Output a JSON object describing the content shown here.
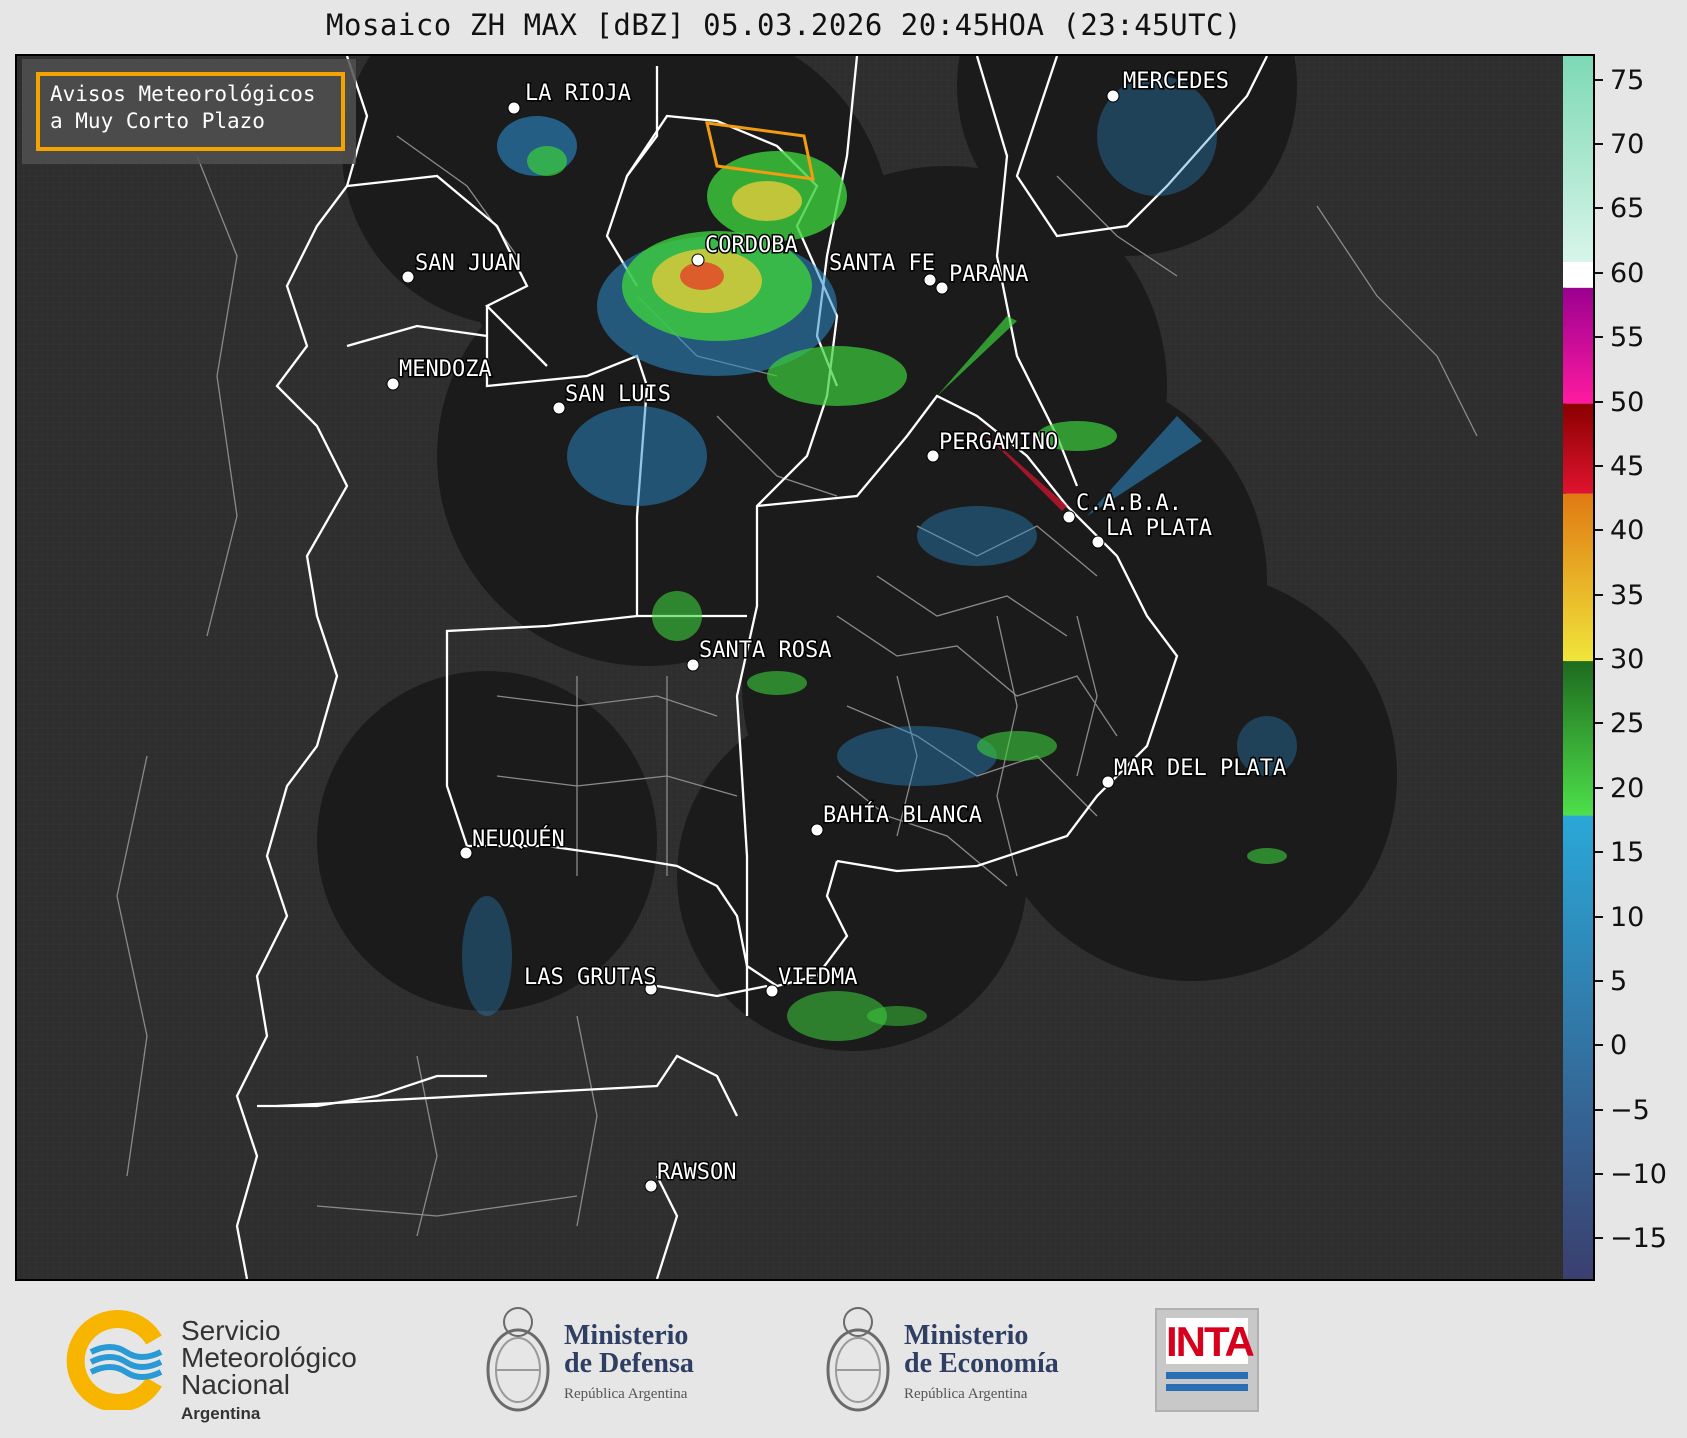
{
  "title": "Mosaico ZH MAX [dBZ] 05.03.2026 20:45HOA (23:45UTC)",
  "notice": {
    "line1": "Avisos Meteorológicos",
    "line2": "a Muy Corto Plazo"
  },
  "colors": {
    "background": "#2e2e2e",
    "radar_coverage": "#1b1b1b",
    "province_border": "#ffffff",
    "department_border": "#8a8a8a",
    "notice_border": "#f5a300",
    "warning_polygon": "#f39c12"
  },
  "cities": [
    {
      "name": "LA RIOJA"
    },
    {
      "name": "MERCEDES"
    },
    {
      "name": "SAN JUAN"
    },
    {
      "name": "CORDOBA"
    },
    {
      "name": "SANTA FE"
    },
    {
      "name": "PARANA"
    },
    {
      "name": "MENDOZA"
    },
    {
      "name": "SAN LUIS"
    },
    {
      "name": "PERGAMINO"
    },
    {
      "name": "C.A.B.A."
    },
    {
      "name": "LA PLATA"
    },
    {
      "name": "SANTA ROSA"
    },
    {
      "name": "MAR DEL PLATA"
    },
    {
      "name": "BAHÍA BLANCA"
    },
    {
      "name": "NEUQUÉN"
    },
    {
      "name": "LAS GRUTAS"
    },
    {
      "name": "VIEDMA"
    },
    {
      "name": "RAWSON"
    }
  ],
  "colorbar": {
    "unit": "dBZ",
    "min": -18,
    "max": 77,
    "ticks": [
      "75",
      "70",
      "65",
      "60",
      "55",
      "50",
      "45",
      "40",
      "35",
      "30",
      "25",
      "20",
      "15",
      "10",
      "5",
      "0",
      "−5",
      "−10",
      "−15"
    ],
    "segments": [
      {
        "from": -18,
        "to": 18,
        "color_low": "#3a3f6e",
        "color_high": "#2aa8d8"
      },
      {
        "from": 18,
        "to": 30,
        "color_low": "#4ee04a",
        "color_high": "#1e6b1e"
      },
      {
        "from": 30,
        "to": 43,
        "color_low": "#f0e53a",
        "color_high": "#e07a12"
      },
      {
        "from": 43,
        "to": 50,
        "color_low": "#e0132f",
        "color_high": "#8a0000"
      },
      {
        "from": 50,
        "to": 59,
        "color_low": "#ff1aa0",
        "color_high": "#9a0090"
      },
      {
        "from": 59,
        "to": 61,
        "color_low": "#ffffff",
        "color_high": "#ffffff"
      },
      {
        "from": 61,
        "to": 77,
        "color_low": "#d8f5ea",
        "color_high": "#7dd9b5"
      }
    ]
  },
  "logos": {
    "smn": {
      "line1": "Servicio",
      "line2": "Meteorológico",
      "line3": "Nacional",
      "sub": "Argentina"
    },
    "defensa": {
      "line1": "Ministerio",
      "line2": "de Defensa",
      "sub": "República Argentina"
    },
    "economia": {
      "line1": "Ministerio",
      "line2": "de Economía",
      "sub": "República Argentina"
    },
    "inta": {
      "label": "INTA"
    }
  }
}
